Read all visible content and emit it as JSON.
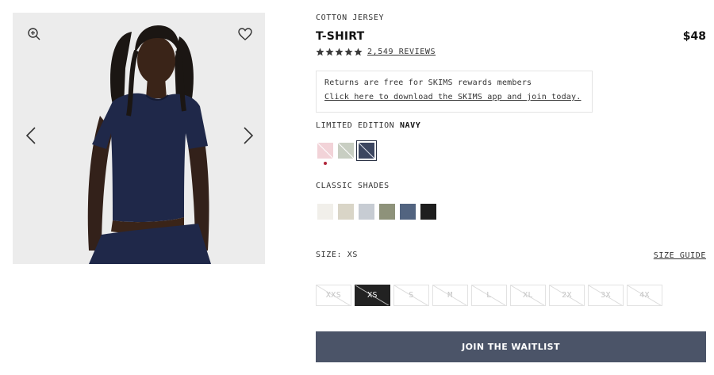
{
  "product": {
    "category": "COTTON JERSEY",
    "name": "T-SHIRT",
    "price": "$48",
    "rating": 5,
    "reviews_label": "2,549 REVIEWS"
  },
  "promo": {
    "line1": "Returns are free for SKIMS rewards members",
    "line2": "Click here to download the SKIMS app and join today."
  },
  "gallery": {
    "icons": [
      "zoom-in-icon",
      "heart-icon",
      "chevron-left-icon",
      "chevron-right-icon"
    ]
  },
  "limited_edition": {
    "label": "LIMITED EDITION",
    "selected_color": "NAVY",
    "swatches": [
      {
        "name": "pink",
        "color": "#f2d3d8",
        "sold_out": true,
        "new": true
      },
      {
        "name": "sage",
        "color": "#c8cec2",
        "sold_out": true,
        "new": false
      },
      {
        "name": "navy",
        "color": "#3c4660",
        "sold_out": true,
        "new": false,
        "selected": true
      }
    ]
  },
  "classic_shades": {
    "label": "CLASSIC SHADES",
    "swatches": [
      {
        "name": "marble",
        "color": "#f1efea"
      },
      {
        "name": "stone",
        "color": "#d9d5c7"
      },
      {
        "name": "light-gray-blue",
        "color": "#c7ccd3"
      },
      {
        "name": "olive",
        "color": "#8e927a"
      },
      {
        "name": "slate-blue",
        "color": "#526480"
      },
      {
        "name": "onyx",
        "color": "#1e1e1e"
      }
    ]
  },
  "size": {
    "label": "SIZE: XS",
    "guide_label": "SIZE GUIDE",
    "options": [
      "XXS",
      "XS",
      "S",
      "M",
      "L",
      "XL",
      "2X",
      "3X",
      "4X"
    ],
    "selected": "XS"
  },
  "cta": {
    "label": "JOIN THE WAITLIST",
    "color": "#4b5468"
  }
}
